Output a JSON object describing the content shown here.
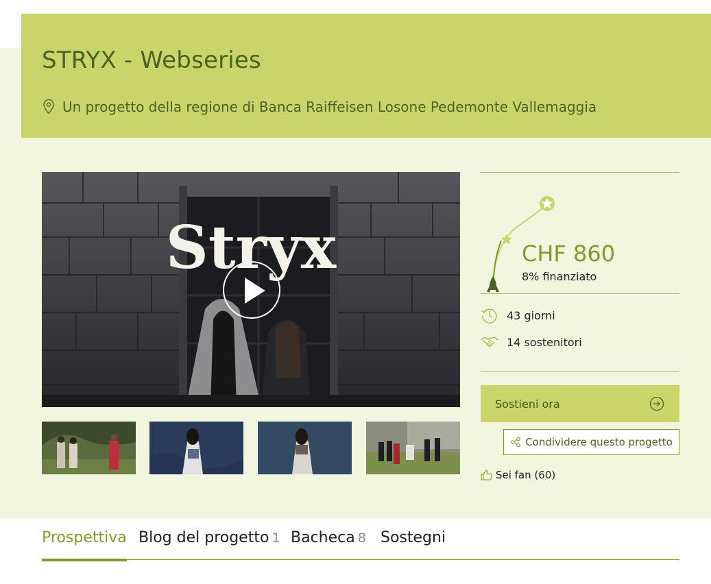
{
  "project": {
    "title": "STRYX - Webseries",
    "region_text": "Un progetto della regione di Banca Raiffeisen Losone Pedemonte Vallemaggia"
  },
  "video": {
    "title_overlay": "Stryx"
  },
  "funding": {
    "amount": "CHF 860",
    "funded_label": "8% finanziato",
    "funded_fraction": 0.08,
    "days_left": "43 giorni",
    "supporters": "14 sostenitori"
  },
  "actions": {
    "support_label": "Sostieni ora",
    "share_label": "Condividere questo progetto",
    "fan_label": "Sei fan (60)"
  },
  "tabs": [
    {
      "label": "Prospettiva",
      "count": ""
    },
    {
      "label": "Blog del progetto",
      "count": "1"
    },
    {
      "label": "Bacheca",
      "count": "8"
    },
    {
      "label": "Sostegni",
      "count": ""
    }
  ],
  "colors": {
    "accent": "#c9d56a",
    "accent_dark": "#7f9a2b",
    "text_green": "#4b6324",
    "page_bg": "#f3f6df"
  }
}
